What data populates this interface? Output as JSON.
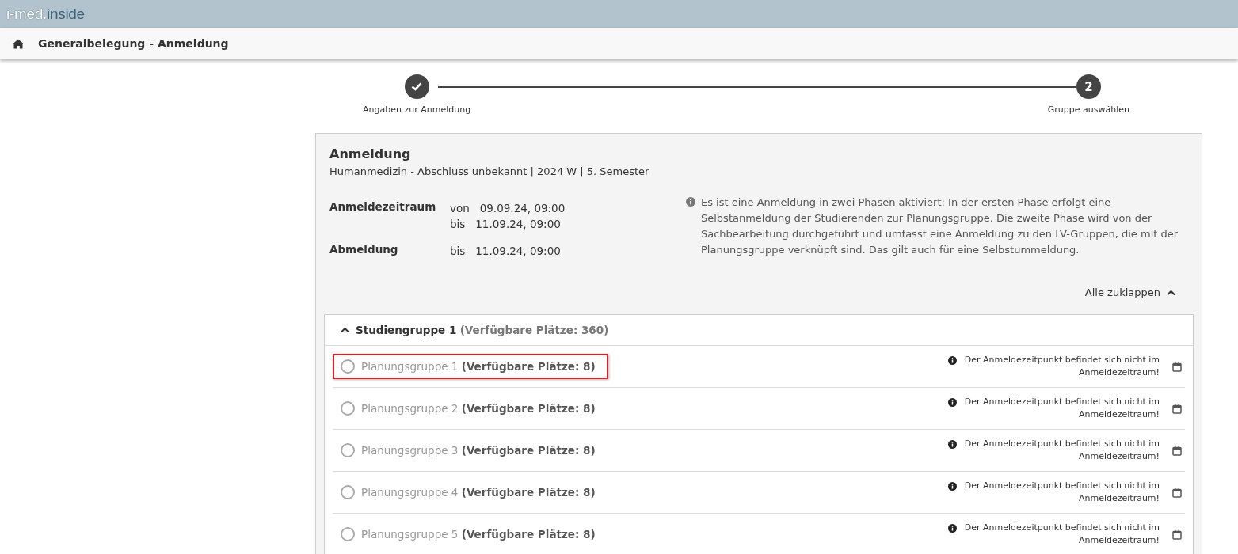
{
  "logo": {
    "prefix": "i-med.",
    "suffix": "inside"
  },
  "nav": {
    "title": "Generalbelegung - Anmeldung"
  },
  "steps": [
    {
      "kind": "done",
      "label": "Angaben zur Anmeldung"
    },
    {
      "kind": "number",
      "number": "2",
      "label": "Gruppe auswählen"
    }
  ],
  "card": {
    "title": "Anmeldung",
    "subtitle": "Humanmedizin - Abschluss unbekannt | 2024 W | 5. Semester",
    "periods": [
      {
        "label": "Anmeldezeitraum",
        "lines": [
          {
            "prefix": "von",
            "value": "09.09.24, 09:00"
          },
          {
            "prefix": "bis",
            "value": "11.09.24, 09:00"
          }
        ]
      },
      {
        "label": "Abmeldung",
        "lines": [
          {
            "prefix": "bis",
            "value": "11.09.24, 09:00"
          }
        ]
      }
    ],
    "info": "Es ist eine Anmeldung in zwei Phasen aktiviert: In der ersten Phase erfolgt eine Selbstanmeldung der Studierenden zur Planungsgruppe. Die zweite Phase wird von der Sachbearbeitung durchgeführt und umfasst eine Anmeldung zu den LV-Gruppen, die mit der Planungsgruppe verknüpft sind. Das gilt auch für eine Selbstummeldung.",
    "collapse_all": "Alle zuklappen"
  },
  "group": {
    "name": "Studiengruppe 1",
    "places": "(Verfügbare Plätze: 360)",
    "expanded": true,
    "rows": [
      {
        "name": "Planungsgruppe 1",
        "places": "(Verfügbare Plätze: 8)",
        "selected": false,
        "highlighted": true,
        "notice": "Der Anmeldezeitpunkt befindet sich nicht im Anmeldezeitraum!"
      },
      {
        "name": "Planungsgruppe 2",
        "places": "(Verfügbare Plätze: 8)",
        "selected": false,
        "highlighted": false,
        "notice": "Der Anmeldezeitpunkt befindet sich nicht im Anmeldezeitraum!"
      },
      {
        "name": "Planungsgruppe 3",
        "places": "(Verfügbare Plätze: 8)",
        "selected": false,
        "highlighted": false,
        "notice": "Der Anmeldezeitpunkt befindet sich nicht im Anmeldezeitraum!"
      },
      {
        "name": "Planungsgruppe 4",
        "places": "(Verfügbare Plätze: 8)",
        "selected": false,
        "highlighted": false,
        "notice": "Der Anmeldezeitpunkt befindet sich nicht im Anmeldezeitraum!"
      },
      {
        "name": "Planungsgruppe 5",
        "places": "(Verfügbare Plätze: 8)",
        "selected": false,
        "highlighted": false,
        "notice": "Der Anmeldezeitpunkt befindet sich nicht im Anmeldezeitraum!"
      }
    ]
  }
}
